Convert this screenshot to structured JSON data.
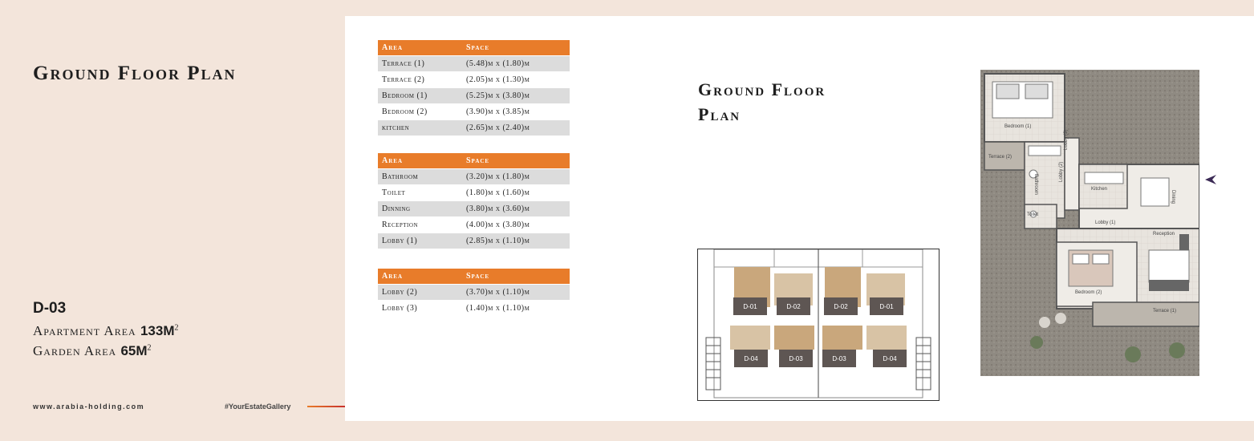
{
  "left": {
    "title": "Ground Floor Plan",
    "unit_code": "D-03",
    "apartment_label": "Apartment Area",
    "apartment_value": "133M",
    "apartment_sup": "2",
    "garden_label": "Garden Area",
    "garden_value": "65M",
    "garden_sup": "2",
    "website": "www.arabia-holding.com",
    "hashtag": "#YourEstateGallery"
  },
  "tables": [
    {
      "headers": [
        "Area",
        "Space"
      ],
      "rows": [
        [
          "Terrace (1)",
          "(5.48)m x (1.80)m"
        ],
        [
          "Terrace (2)",
          "(2.05)m x (1.30)m"
        ],
        [
          "Bedroom (1)",
          "(5.25)m x (3.80)m"
        ],
        [
          "Bedroom (2)",
          "(3.90)m x (3.85)m"
        ],
        [
          "kitchen",
          "(2.65)m x (2.40)m"
        ]
      ]
    },
    {
      "headers": [
        "Area",
        "Space"
      ],
      "rows": [
        [
          "Bathroom",
          "(3.20)m x (1.80)m"
        ],
        [
          "Toilet",
          "(1.80)m x (1.60)m"
        ],
        [
          "Dinning",
          "(3.80)m x (3.60)m"
        ],
        [
          "Reception",
          "(4.00)m x (3.80)m"
        ],
        [
          "Lobby (1)",
          "(2.85)m x (1.10)m"
        ]
      ]
    },
    {
      "headers": [
        "Area",
        "Space"
      ],
      "rows": [
        [
          "Lobby (2)",
          "(3.70)m x (1.10)m"
        ],
        [
          "Lobby (3)",
          "(1.40)m x (1.10)m"
        ]
      ]
    }
  ],
  "middle": {
    "title_line1": "Ground Floor",
    "title_line2": "Plan"
  },
  "site_plan": {
    "top_units": [
      "D-01",
      "D-02",
      "D-02",
      "D-01"
    ],
    "bottom_units": [
      "D-04",
      "D-03",
      "D-03",
      "D-04"
    ]
  },
  "plan_labels": {
    "bedroom1": "Bedroom (1)",
    "terrace2": "Terrace (2)",
    "lobby3": "Lobby (3)",
    "bathroom": "Bathroom",
    "lobby2": "Lobby (2)",
    "kitchen": "Kitchen",
    "dining": "Dining",
    "toilet": "Toilet",
    "lobby1": "Lobby (1)",
    "reception": "Reception",
    "bedroom2": "Bedroom (2)",
    "terrace1": "Terrace (1)"
  },
  "colors": {
    "accent": "#e87c2a",
    "unit_box": "#5e5653",
    "beige": "#f3e5db"
  }
}
